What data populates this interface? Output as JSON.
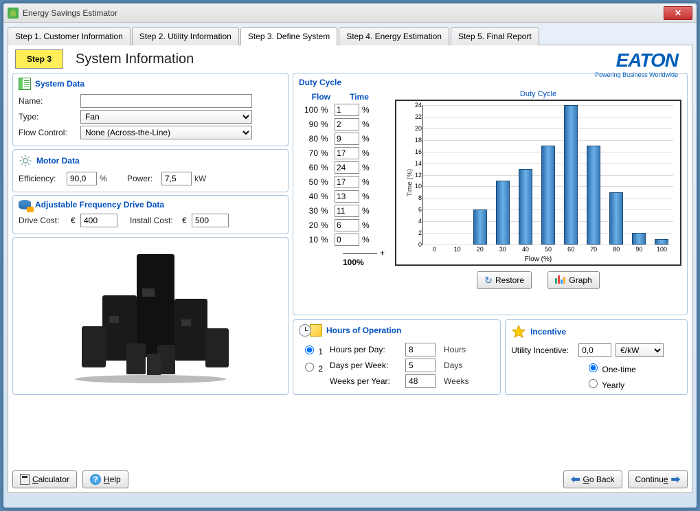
{
  "window": {
    "title": "Energy Savings Estimator"
  },
  "tabs": [
    {
      "label": "Step 1. Customer Information"
    },
    {
      "label": "Step 2. Utility Information"
    },
    {
      "label": "Step 3. Define System"
    },
    {
      "label": "Step 4. Energy Estimation"
    },
    {
      "label": "Step 5. Final Report"
    }
  ],
  "active_tab_index": 2,
  "header": {
    "step_badge": "Step 3",
    "page_title": "System Information",
    "brand": "EATON",
    "brand_tagline": "Powering Business Worldwide"
  },
  "system_data": {
    "title": "System Data",
    "name_label": "Name:",
    "name_value": "",
    "type_label": "Type:",
    "type_value": "Fan",
    "flow_control_label": "Flow Control:",
    "flow_control_value": "None (Across-the-Line)"
  },
  "motor_data": {
    "title": "Motor Data",
    "efficiency_label": "Efficiency:",
    "efficiency_value": "90,0",
    "efficiency_unit": "%",
    "power_label": "Power:",
    "power_value": "7,5",
    "power_unit": "kW"
  },
  "afd_data": {
    "title": "Adjustable Frequency Drive Data",
    "drive_cost_label": "Drive Cost:",
    "drive_cost_currency": "€",
    "drive_cost_value": "400",
    "install_cost_label": "Install Cost:",
    "install_cost_currency": "€",
    "install_cost_value": "500"
  },
  "duty_cycle": {
    "title": "Duty Cycle",
    "flow_hd": "Flow",
    "time_hd": "Time",
    "pct": "%",
    "rows": [
      {
        "flow": "100",
        "time": "1"
      },
      {
        "flow": "90",
        "time": "2"
      },
      {
        "flow": "80",
        "time": "9"
      },
      {
        "flow": "70",
        "time": "17"
      },
      {
        "flow": "60",
        "time": "24"
      },
      {
        "flow": "50",
        "time": "17"
      },
      {
        "flow": "40",
        "time": "13"
      },
      {
        "flow": "30",
        "time": "11"
      },
      {
        "flow": "20",
        "time": "6"
      },
      {
        "flow": "10",
        "time": "0"
      }
    ],
    "plus": "+",
    "total": "100%",
    "restore_btn": "Restore",
    "graph_btn": "Graph"
  },
  "chart_data": {
    "type": "bar",
    "title": "Duty Cycle",
    "xlabel": "Flow (%)",
    "ylabel": "Time (%)",
    "categories": [
      0,
      10,
      20,
      30,
      40,
      50,
      60,
      70,
      80,
      90,
      100
    ],
    "values": [
      0,
      0,
      6,
      11,
      13,
      17,
      24,
      17,
      9,
      2,
      1
    ],
    "xlim": [
      0,
      100
    ],
    "ylim": [
      0,
      24
    ],
    "yticks": [
      0,
      2,
      4,
      6,
      8,
      10,
      12,
      14,
      16,
      18,
      20,
      22,
      24
    ]
  },
  "hours": {
    "title": "Hours of Operation",
    "opt1": "1",
    "opt2": "2",
    "hpd_label": "Hours per Day:",
    "hpd_value": "8",
    "hpd_unit": "Hours",
    "dpw_label": "Days per Week:",
    "dpw_value": "5",
    "dpw_unit": "Days",
    "wpy_label": "Weeks per Year:",
    "wpy_value": "48",
    "wpy_unit": "Weeks"
  },
  "incentive": {
    "title": "Incentive",
    "label": "Utility Incentive:",
    "value": "0,0",
    "unit": "€/kW",
    "one_time": "One-time",
    "yearly": "Yearly"
  },
  "footer": {
    "calculator": "Calculator",
    "help": "Help",
    "go_back": "Go Back",
    "continue": "Continue"
  }
}
